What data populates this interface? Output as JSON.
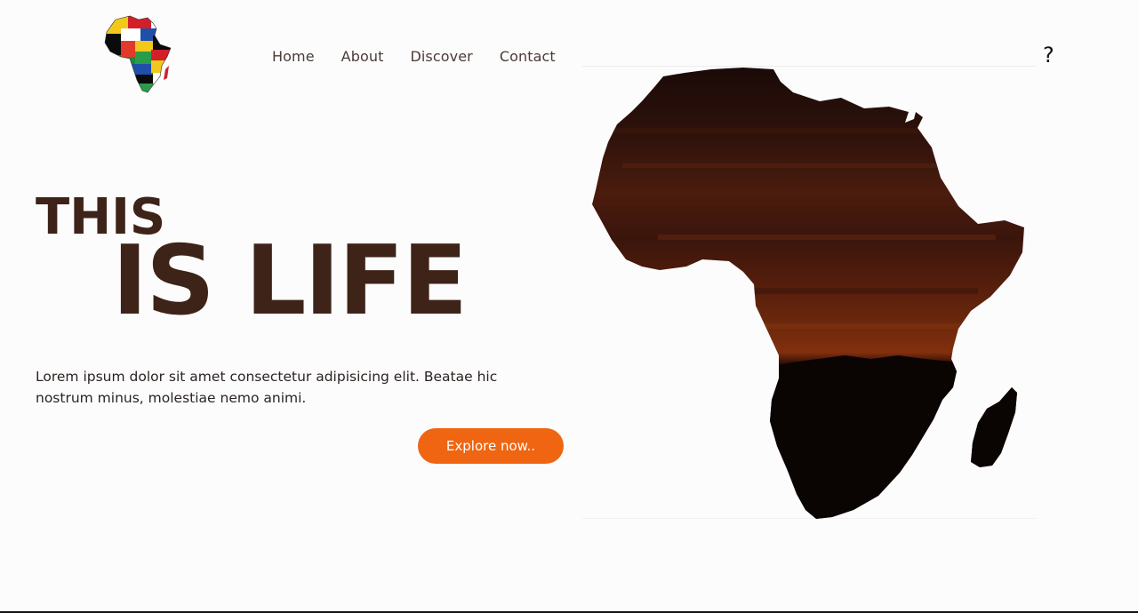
{
  "header": {
    "logo_icon": "africa-flags-logo-icon",
    "nav": [
      {
        "label": "Home"
      },
      {
        "label": "About"
      },
      {
        "label": "Discover"
      },
      {
        "label": "Contact"
      }
    ],
    "help_icon_glyph": "?"
  },
  "hero": {
    "title_line1": "THIS",
    "title_line2": "IS LIFE",
    "description": "Lorem ipsum dolor sit amet consectetur adipisicing elit. Beatae hic nostrum minus, molestiae nemo animi.",
    "cta_label": "Explore now.."
  },
  "image": {
    "icon": "africa-silhouette-sunset-image"
  },
  "colors": {
    "title": "#3e2319",
    "accent": "#ef6511",
    "text": "#2a2422",
    "background": "#fdfcfc"
  }
}
